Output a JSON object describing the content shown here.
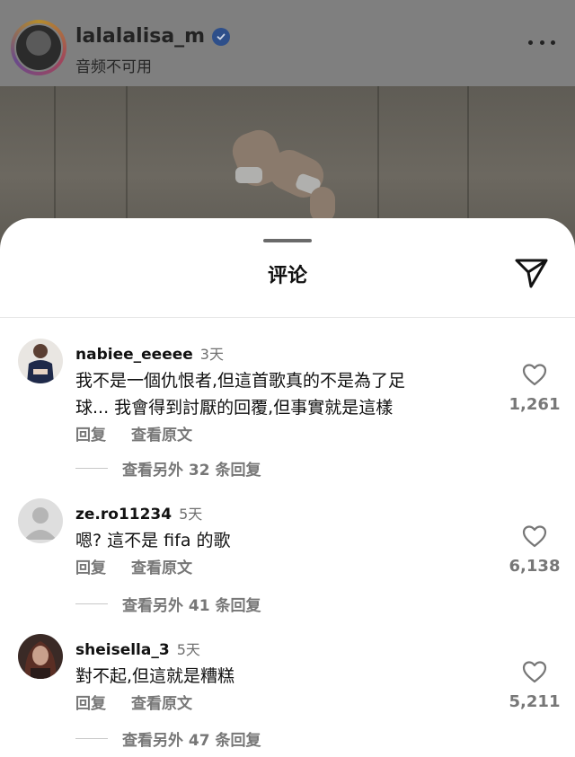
{
  "post": {
    "username": "lalalalisa_m",
    "audio_status": "音频不可用",
    "verified_icon": "verified-badge-icon",
    "more_icon": "more-options-icon"
  },
  "sheet": {
    "title": "评论",
    "send_icon": "send-icon"
  },
  "comments": [
    {
      "username": "nabiee_eeeee",
      "time": "3天",
      "lines": [
        "我不是一個仇恨者,但這首歌真的不是為了足",
        "球... 我會得到討厭的回覆,但事實就是這樣"
      ],
      "reply_label": "回复",
      "translate_label": "查看原文",
      "view_replies": "查看另外 32 条回复",
      "likes": "1,261"
    },
    {
      "username": "ze.ro11234",
      "time": "5天",
      "lines": [
        "嗯? 這不是 fifa 的歌"
      ],
      "reply_label": "回复",
      "translate_label": "查看原文",
      "view_replies": "查看另外 41 条回复",
      "likes": "6,138"
    },
    {
      "username": "sheisella_3",
      "time": "5天",
      "lines": [
        "對不起,但這就是糟糕"
      ],
      "reply_label": "回复",
      "translate_label": "查看原文",
      "view_replies": "查看另外 47 条回复",
      "likes": "5,211"
    }
  ]
}
